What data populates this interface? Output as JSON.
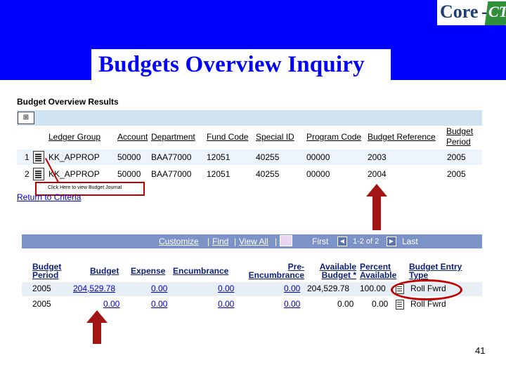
{
  "header": {
    "title": "Budgets Overview Inquiry",
    "logo": {
      "core": "Core",
      "dash": "-",
      "ct": "CT"
    }
  },
  "results": {
    "title": "Budget Overview Results",
    "grid_icon": "grid-options-icon",
    "columns": [
      "Ledger Group",
      "Account",
      "Department",
      "Fund Code",
      "Special ID",
      "Program Code",
      "Budget Reference",
      "Budget Period"
    ],
    "rows": [
      {
        "num": "1",
        "ledger_group": "KK_APPROP",
        "account": "50000",
        "department": "BAA77000",
        "fund_code": "12051",
        "special_id": "40255",
        "program_code": "00000",
        "budget_reference": "2003",
        "budget_period": "2005"
      },
      {
        "num": "2",
        "ledger_group": "KK_APPROP",
        "account": "50000",
        "department": "BAA77000",
        "fund_code": "12051",
        "special_id": "40255",
        "program_code": "00000",
        "budget_reference": "2004",
        "budget_period": "2005"
      }
    ],
    "callout": "Click Here to view Budget Journal",
    "return_link": "Return to Criteria"
  },
  "detail": {
    "nav": {
      "customize": "Customize",
      "find": "Find",
      "view_all": "View All",
      "separator": "|",
      "first": "First",
      "range": "1-2 of 2",
      "last": "Last"
    },
    "columns": {
      "budget_period": [
        "Budget",
        "Period"
      ],
      "budget": "Budget",
      "expense": "Expense",
      "encumbrance": "Encumbrance",
      "pre_encumbrance": [
        "Pre-",
        "Encumbrance"
      ],
      "available_budget": [
        "Available",
        "Budget *"
      ],
      "percent_available": [
        "Percent",
        "Available"
      ],
      "budget_entry_type": [
        "Budget Entry",
        "Type"
      ]
    },
    "rows": [
      {
        "budget_period": "2005",
        "budget": "204,529.78",
        "expense": "0.00",
        "encumbrance": "0.00",
        "pre_encumbrance": "0.00",
        "available_budget": "204,529.78",
        "percent_available": "100.00",
        "budget_entry_type": "Roll Fwrd"
      },
      {
        "budget_period": "2005",
        "budget": "0.00",
        "expense": "0.00",
        "encumbrance": "0.00",
        "pre_encumbrance": "0.00",
        "available_budget": "0.00",
        "percent_available": "0.00",
        "budget_entry_type": "Roll Fwrd"
      }
    ]
  },
  "footer": {
    "page_number": "41"
  },
  "colors": {
    "header_blue": "#0000ff",
    "highlight_red": "#c00000",
    "nav_band": "#7b93c6",
    "grid_band": "#cfe3f3"
  }
}
